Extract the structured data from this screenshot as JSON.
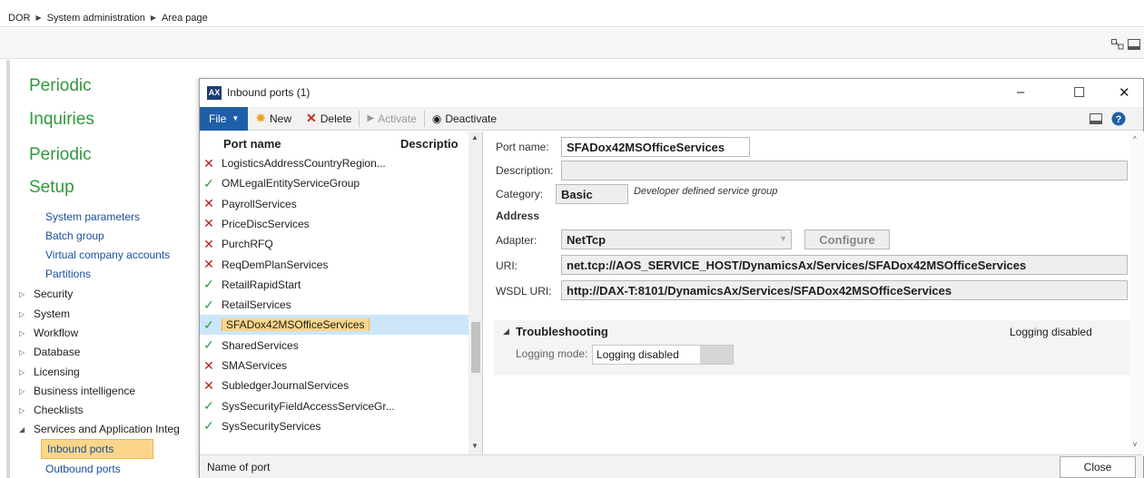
{
  "breadcrumb": {
    "items": [
      "DOR",
      "System administration",
      "Area page"
    ]
  },
  "areapage": {
    "headings": [
      "Periodic",
      "Inquiries",
      "Periodic",
      "Setup"
    ],
    "setup_links": [
      "System parameters",
      "Batch group",
      "Virtual company accounts",
      "Partitions"
    ],
    "tree": [
      "Security",
      "System",
      "Workflow",
      "Database",
      "Licensing",
      "Business intelligence",
      "Checklists"
    ],
    "services_group": "Services and Application Integ",
    "services_children": [
      "Inbound ports",
      "Outbound ports"
    ]
  },
  "dialog": {
    "title": "Inbound ports (1)",
    "app_icon": "AX",
    "window_controls": {
      "minimize": "–",
      "maximize": "☐",
      "close": "✕"
    },
    "toolbar": {
      "file": "File",
      "new": "New",
      "delete": "Delete",
      "activate": "Activate",
      "deactivate": "Deactivate"
    },
    "grid": {
      "col_port_name": "Port name",
      "col_description": "Descriptio",
      "rows": [
        {
          "status": "bad",
          "name": "LogisticsAddressCountryRegion..."
        },
        {
          "status": "ok",
          "name": "OMLegalEntityServiceGroup"
        },
        {
          "status": "bad",
          "name": "PayrollServices"
        },
        {
          "status": "bad",
          "name": "PriceDiscServices"
        },
        {
          "status": "bad",
          "name": "PurchRFQ"
        },
        {
          "status": "bad",
          "name": "ReqDemPlanServices"
        },
        {
          "status": "ok",
          "name": "RetailRapidStart"
        },
        {
          "status": "ok",
          "name": "RetailServices"
        },
        {
          "status": "ok",
          "name": "SFADox42MSOfficeServices"
        },
        {
          "status": "ok",
          "name": "SharedServices"
        },
        {
          "status": "bad",
          "name": "SMAServices"
        },
        {
          "status": "bad",
          "name": "SubledgerJournalServices"
        },
        {
          "status": "ok",
          "name": "SysSecurityFieldAccessServiceGr..."
        },
        {
          "status": "ok",
          "name": "SysSecurityServices"
        }
      ]
    },
    "detail": {
      "port_name_label": "Port name:",
      "port_name": "SFADox42MSOfficeServices",
      "description_label": "Description:",
      "category_label": "Category:",
      "category": "Basic",
      "category_note": "Developer defined service group",
      "address_heading": "Address",
      "adapter_label": "Adapter:",
      "adapter": "NetTcp",
      "configure": "Configure",
      "uri_label": "URI:",
      "uri": "net.tcp://AOS_SERVICE_HOST/DynamicsAx/Services/SFADox42MSOfficeServices",
      "wsdl_label": "WSDL URI:",
      "wsdl": "http://DAX-T:8101/DynamicsAx/Services/SFADox42MSOfficeServices",
      "troubleshooting": "Troubleshooting",
      "troubleshooting_summary": "Logging disabled",
      "logging_mode_label": "Logging mode:",
      "logging_mode": "Logging disabled"
    },
    "statusbar": {
      "text": "Name of port",
      "close": "Close"
    }
  }
}
